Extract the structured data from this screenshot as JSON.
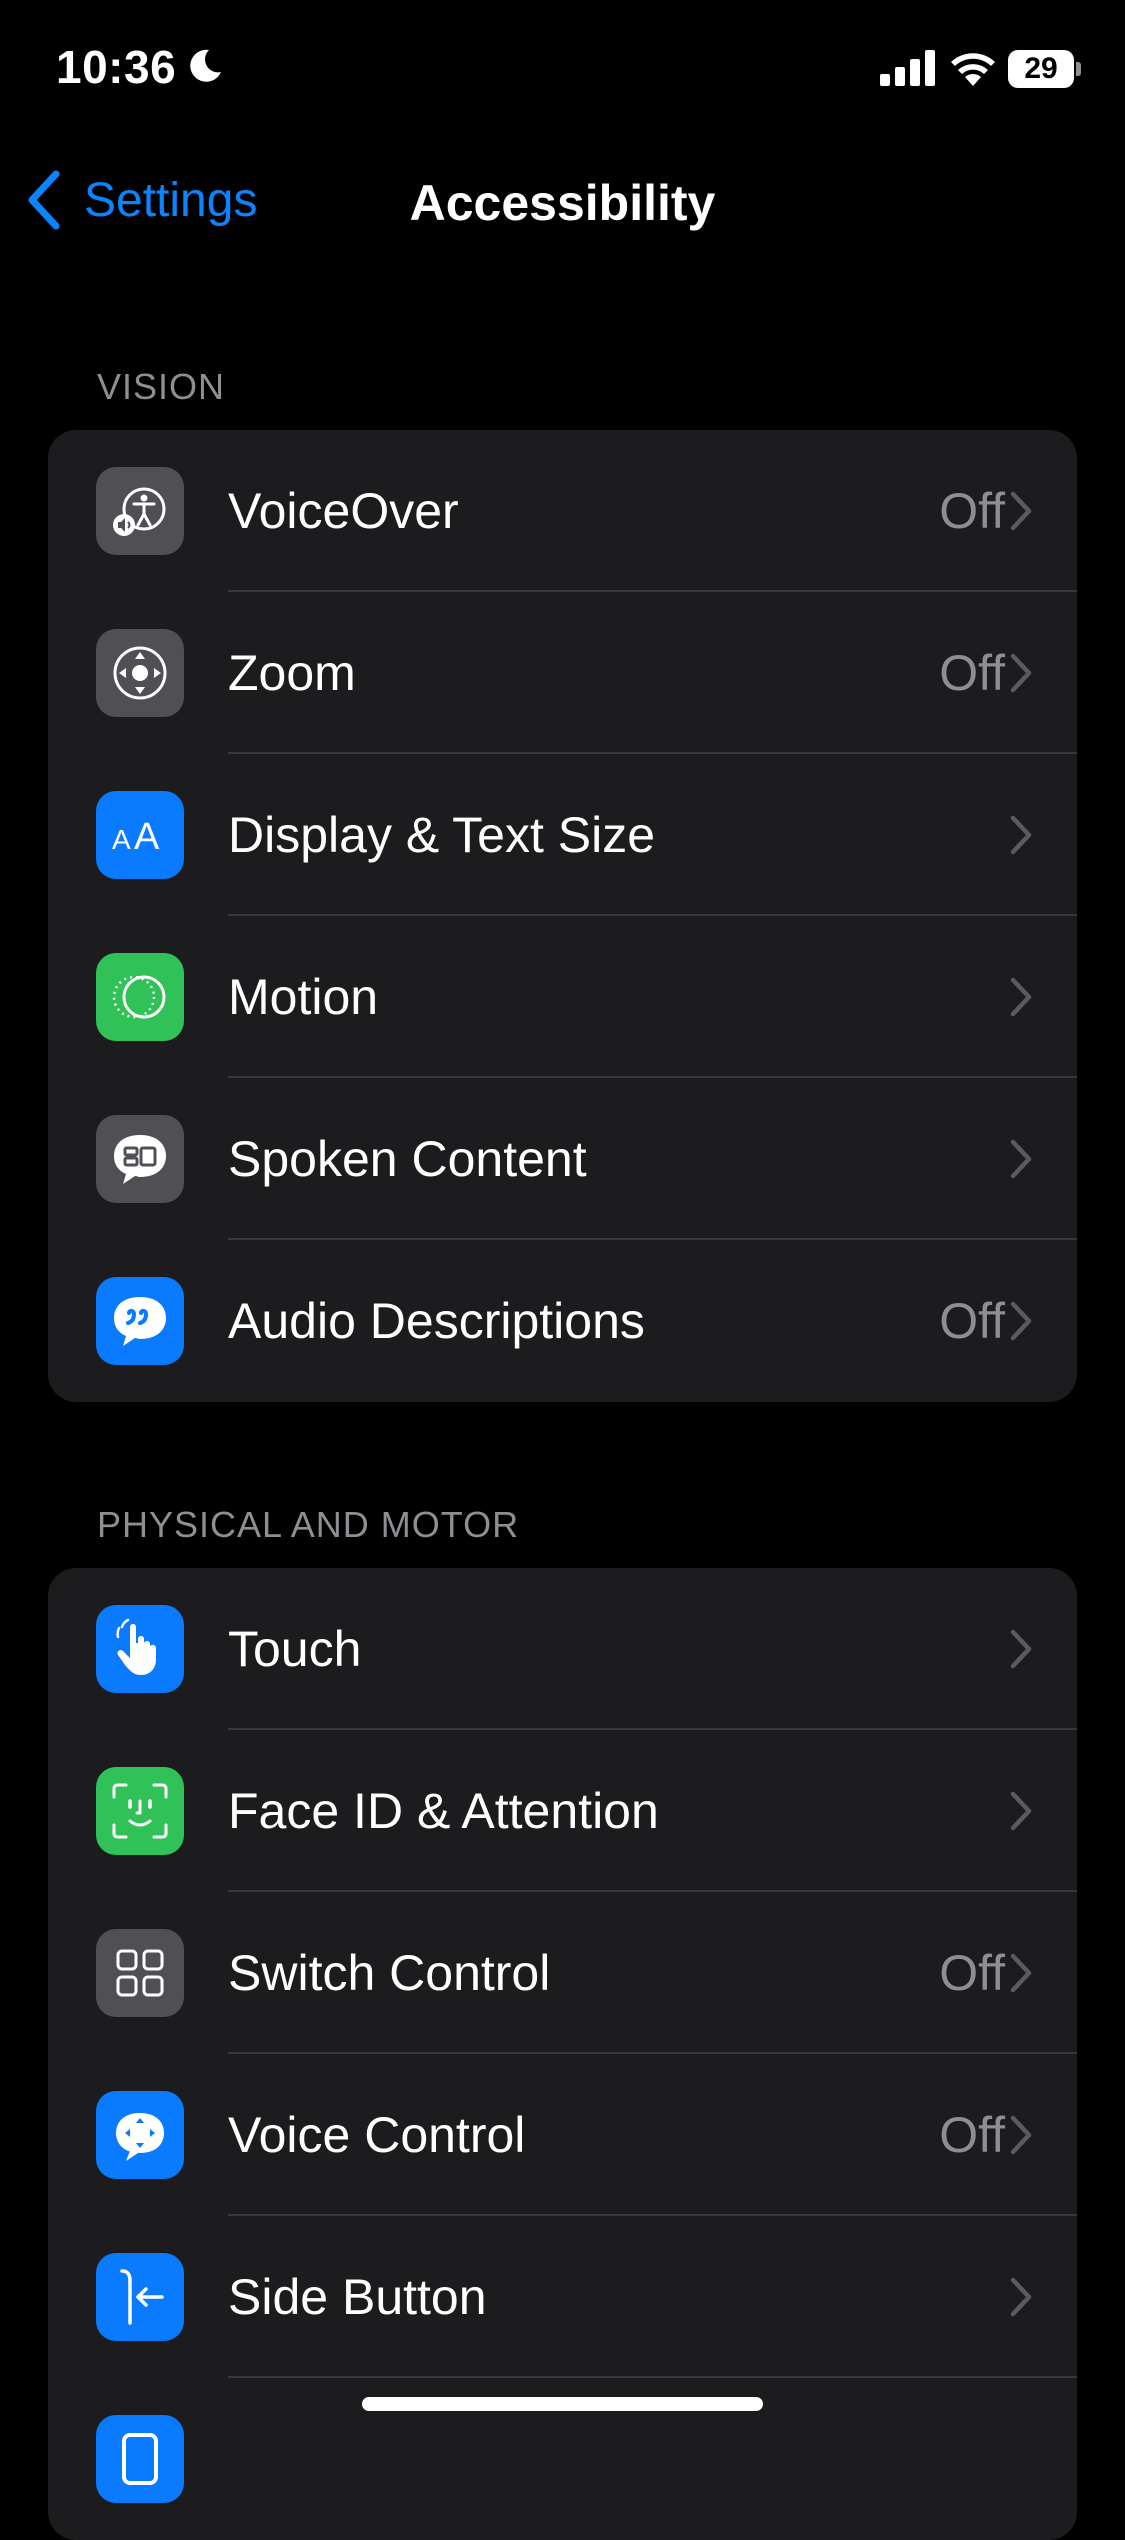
{
  "status_bar": {
    "time": "10:36",
    "battery": "29"
  },
  "nav": {
    "back_label": "Settings",
    "title": "Accessibility"
  },
  "sections": [
    {
      "header": "VISION",
      "rows": [
        {
          "label": "VoiceOver",
          "value": "Off",
          "icon": "voiceover-icon",
          "icon_bg": "#505054"
        },
        {
          "label": "Zoom",
          "value": "Off",
          "icon": "zoom-icon",
          "icon_bg": "#505054"
        },
        {
          "label": "Display & Text Size",
          "value": "",
          "icon": "display-text-size-icon",
          "icon_bg": "#0a7aff"
        },
        {
          "label": "Motion",
          "value": "",
          "icon": "motion-icon",
          "icon_bg": "#30c157"
        },
        {
          "label": "Spoken Content",
          "value": "",
          "icon": "spoken-content-icon",
          "icon_bg": "#505054"
        },
        {
          "label": "Audio Descriptions",
          "value": "Off",
          "icon": "audio-descriptions-icon",
          "icon_bg": "#0a7aff"
        }
      ]
    },
    {
      "header": "PHYSICAL AND MOTOR",
      "rows": [
        {
          "label": "Touch",
          "value": "",
          "icon": "touch-icon",
          "icon_bg": "#0a7aff"
        },
        {
          "label": "Face ID & Attention",
          "value": "",
          "icon": "face-id-icon",
          "icon_bg": "#30c157"
        },
        {
          "label": "Switch Control",
          "value": "Off",
          "icon": "switch-control-icon",
          "icon_bg": "#505054"
        },
        {
          "label": "Voice Control",
          "value": "Off",
          "icon": "voice-control-icon",
          "icon_bg": "#0a7aff"
        },
        {
          "label": "Side Button",
          "value": "",
          "icon": "side-button-icon",
          "icon_bg": "#0a7aff"
        },
        {
          "label": "",
          "value": "",
          "icon": "partial-row-icon",
          "icon_bg": "#0a7aff"
        }
      ]
    }
  ],
  "colors": {
    "accent": "#0a84ff",
    "background": "#000000",
    "group_bg": "#1c1c1e",
    "secondary_text": "#8e8e93"
  }
}
